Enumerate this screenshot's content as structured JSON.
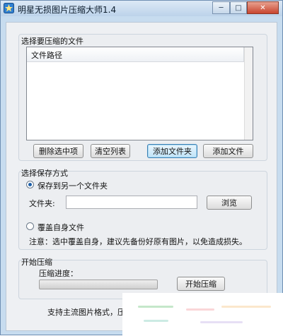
{
  "window": {
    "title": "明星无损图片压缩大师1.4"
  },
  "titlebar_buttons": {
    "minimize": "─",
    "maximize": "□",
    "close": "✕"
  },
  "file_group": {
    "label": "选择要压缩的文件",
    "list_header": "文件路径",
    "buttons": {
      "delete_selected": "删除选中项",
      "clear_list": "清空列表",
      "add_folder": "添加文件夹",
      "add_file": "添加文件"
    }
  },
  "save_group": {
    "label": "选择保存方式",
    "option_other_folder": "保存到另一个文件夹",
    "folder_label": "文件夹:",
    "folder_value": "",
    "browse_button": "浏览",
    "option_overwrite": "覆盖自身文件",
    "overwrite_note": "注意：选中覆盖自身，建议先备份好原有图片，以免造成损失。",
    "selected_option": "other_folder"
  },
  "compress_group": {
    "label": "开始压缩",
    "progress_label": "压缩进度：",
    "progress_fraction": 0,
    "start_button": "开始压缩"
  },
  "footer": {
    "text": "支持主流图片格式，压缩"
  },
  "colors": {
    "progress_fill": "#3bb34a",
    "accent": "#3c7fb1",
    "overlay_dots": [
      "#7fc98a",
      "#f3a3a8",
      "#f6c98e",
      "#8fd3c3",
      "#c9b7e8"
    ]
  }
}
